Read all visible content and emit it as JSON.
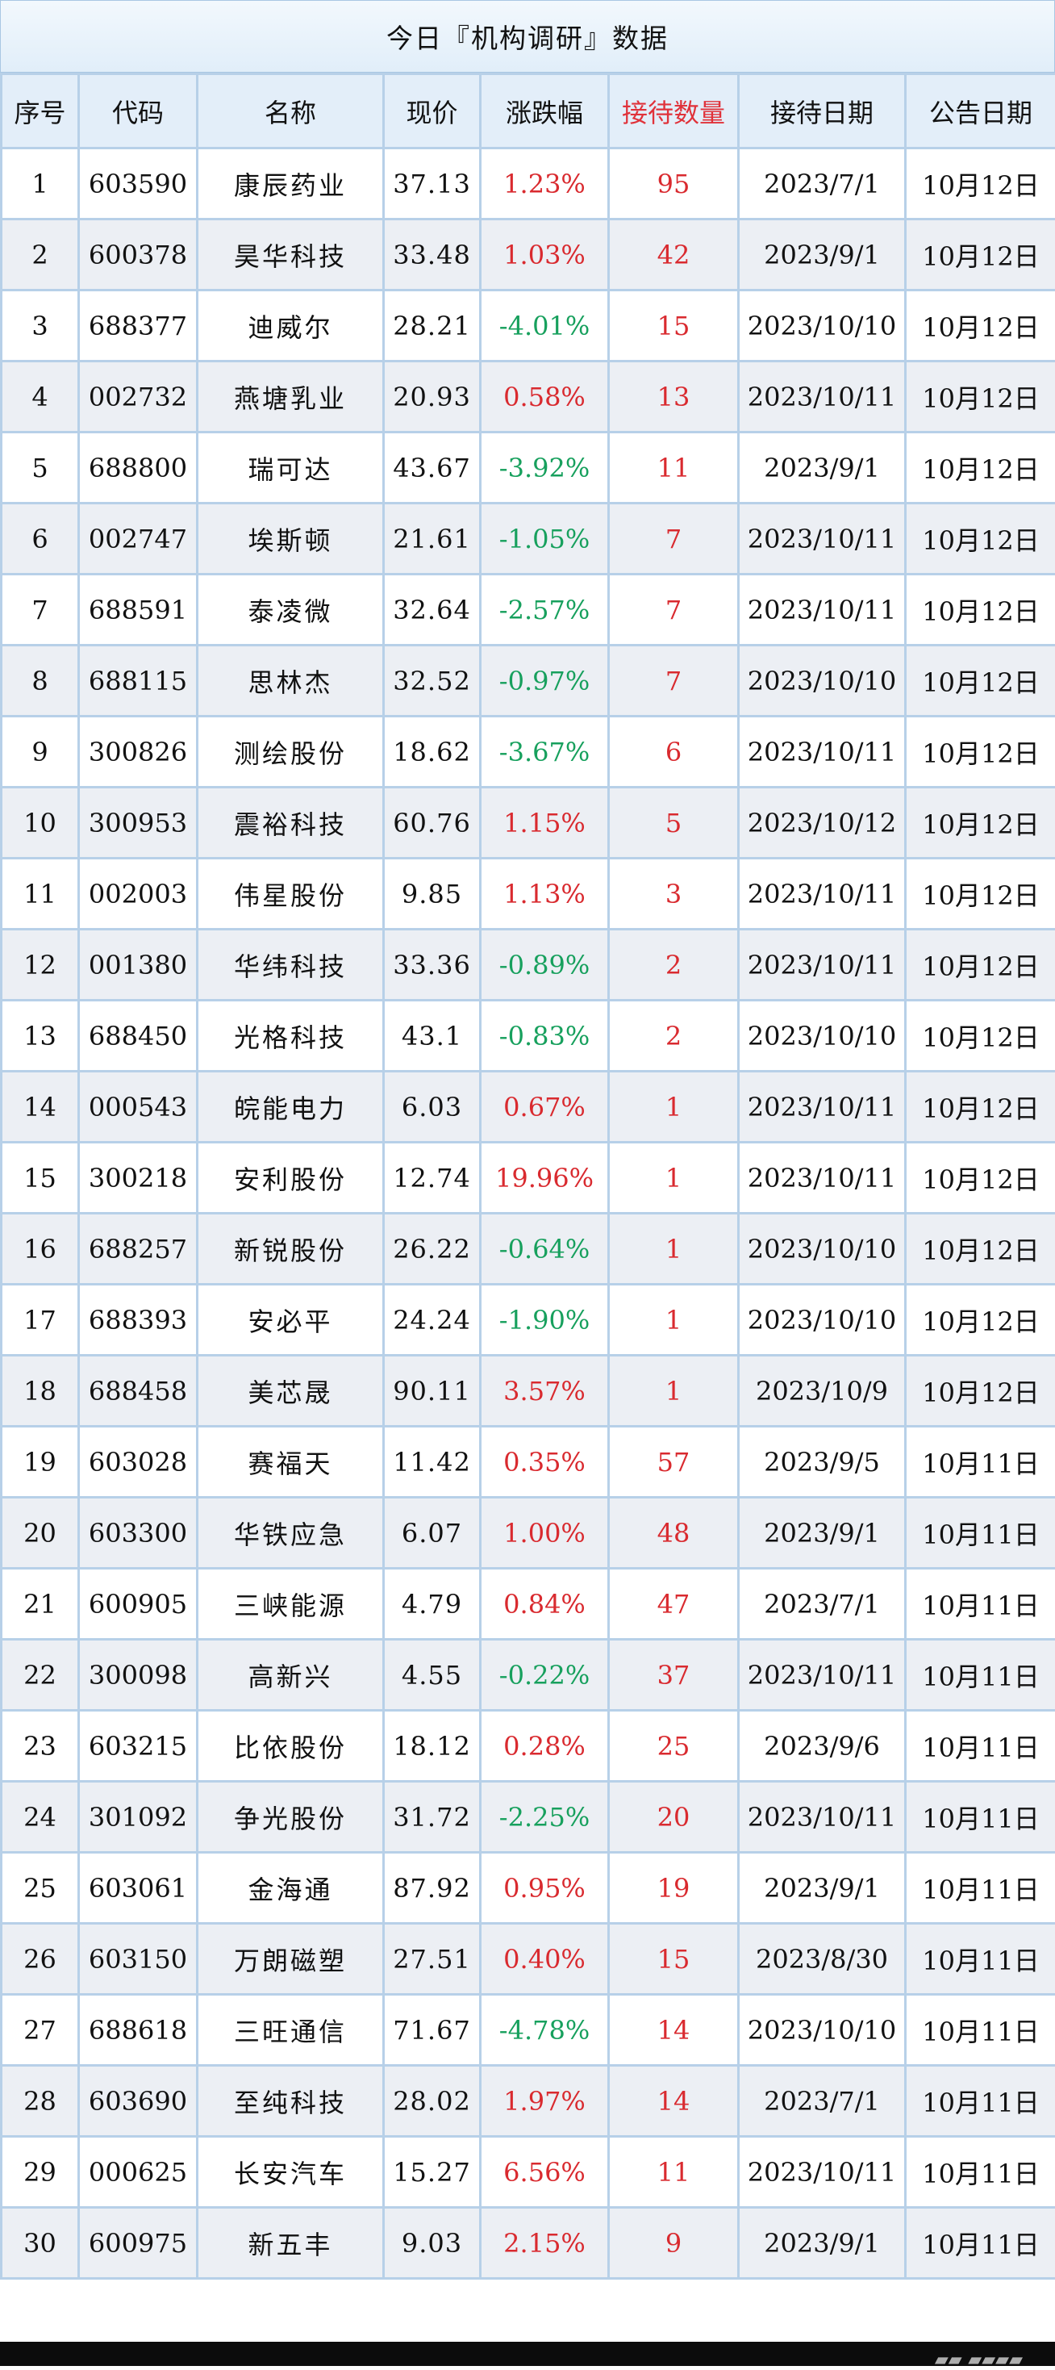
{
  "title": "今日『机构调研』数据",
  "headers": [
    "序号",
    "代码",
    "名称",
    "现价",
    "涨跌幅",
    "接待数量",
    "接待日期",
    "公告日期"
  ],
  "colors": {
    "header_bg": "#e3eef9",
    "border": "#b7d0e8",
    "up": "#d92a2f",
    "down": "#17a05d",
    "alt_row": "#eceff4"
  },
  "rows": [
    {
      "no": "1",
      "code": "603590",
      "name": "康辰药业",
      "price": "37.13",
      "change": "1.23%",
      "count": "95",
      "visit_date": "2023/7/1",
      "announce_date": "10月12日"
    },
    {
      "no": "2",
      "code": "600378",
      "name": "昊华科技",
      "price": "33.48",
      "change": "1.03%",
      "count": "42",
      "visit_date": "2023/9/1",
      "announce_date": "10月12日"
    },
    {
      "no": "3",
      "code": "688377",
      "name": "迪威尔",
      "price": "28.21",
      "change": "-4.01%",
      "count": "15",
      "visit_date": "2023/10/10",
      "announce_date": "10月12日"
    },
    {
      "no": "4",
      "code": "002732",
      "name": "燕塘乳业",
      "price": "20.93",
      "change": "0.58%",
      "count": "13",
      "visit_date": "2023/10/11",
      "announce_date": "10月12日"
    },
    {
      "no": "5",
      "code": "688800",
      "name": "瑞可达",
      "price": "43.67",
      "change": "-3.92%",
      "count": "11",
      "visit_date": "2023/9/1",
      "announce_date": "10月12日"
    },
    {
      "no": "6",
      "code": "002747",
      "name": "埃斯顿",
      "price": "21.61",
      "change": "-1.05%",
      "count": "7",
      "visit_date": "2023/10/11",
      "announce_date": "10月12日"
    },
    {
      "no": "7",
      "code": "688591",
      "name": "泰凌微",
      "price": "32.64",
      "change": "-2.57%",
      "count": "7",
      "visit_date": "2023/10/11",
      "announce_date": "10月12日"
    },
    {
      "no": "8",
      "code": "688115",
      "name": "思林杰",
      "price": "32.52",
      "change": "-0.97%",
      "count": "7",
      "visit_date": "2023/10/10",
      "announce_date": "10月12日"
    },
    {
      "no": "9",
      "code": "300826",
      "name": "测绘股份",
      "price": "18.62",
      "change": "-3.67%",
      "count": "6",
      "visit_date": "2023/10/11",
      "announce_date": "10月12日"
    },
    {
      "no": "10",
      "code": "300953",
      "name": "震裕科技",
      "price": "60.76",
      "change": "1.15%",
      "count": "5",
      "visit_date": "2023/10/12",
      "announce_date": "10月12日"
    },
    {
      "no": "11",
      "code": "002003",
      "name": "伟星股份",
      "price": "9.85",
      "change": "1.13%",
      "count": "3",
      "visit_date": "2023/10/11",
      "announce_date": "10月12日"
    },
    {
      "no": "12",
      "code": "001380",
      "name": "华纬科技",
      "price": "33.36",
      "change": "-0.89%",
      "count": "2",
      "visit_date": "2023/10/11",
      "announce_date": "10月12日"
    },
    {
      "no": "13",
      "code": "688450",
      "name": "光格科技",
      "price": "43.1",
      "change": "-0.83%",
      "count": "2",
      "visit_date": "2023/10/10",
      "announce_date": "10月12日"
    },
    {
      "no": "14",
      "code": "000543",
      "name": "皖能电力",
      "price": "6.03",
      "change": "0.67%",
      "count": "1",
      "visit_date": "2023/10/11",
      "announce_date": "10月12日"
    },
    {
      "no": "15",
      "code": "300218",
      "name": "安利股份",
      "price": "12.74",
      "change": "19.96%",
      "count": "1",
      "visit_date": "2023/10/11",
      "announce_date": "10月12日"
    },
    {
      "no": "16",
      "code": "688257",
      "name": "新锐股份",
      "price": "26.22",
      "change": "-0.64%",
      "count": "1",
      "visit_date": "2023/10/10",
      "announce_date": "10月12日"
    },
    {
      "no": "17",
      "code": "688393",
      "name": "安必平",
      "price": "24.24",
      "change": "-1.90%",
      "count": "1",
      "visit_date": "2023/10/10",
      "announce_date": "10月12日"
    },
    {
      "no": "18",
      "code": "688458",
      "name": "美芯晟",
      "price": "90.11",
      "change": "3.57%",
      "count": "1",
      "visit_date": "2023/10/9",
      "announce_date": "10月12日"
    },
    {
      "no": "19",
      "code": "603028",
      "name": "赛福天",
      "price": "11.42",
      "change": "0.35%",
      "count": "57",
      "visit_date": "2023/9/5",
      "announce_date": "10月11日"
    },
    {
      "no": "20",
      "code": "603300",
      "name": "华铁应急",
      "price": "6.07",
      "change": "1.00%",
      "count": "48",
      "visit_date": "2023/9/1",
      "announce_date": "10月11日"
    },
    {
      "no": "21",
      "code": "600905",
      "name": "三峡能源",
      "price": "4.79",
      "change": "0.84%",
      "count": "47",
      "visit_date": "2023/7/1",
      "announce_date": "10月11日"
    },
    {
      "no": "22",
      "code": "300098",
      "name": "高新兴",
      "price": "4.55",
      "change": "-0.22%",
      "count": "37",
      "visit_date": "2023/10/11",
      "announce_date": "10月11日"
    },
    {
      "no": "23",
      "code": "603215",
      "name": "比依股份",
      "price": "18.12",
      "change": "0.28%",
      "count": "25",
      "visit_date": "2023/9/6",
      "announce_date": "10月11日"
    },
    {
      "no": "24",
      "code": "301092",
      "name": "争光股份",
      "price": "31.72",
      "change": "-2.25%",
      "count": "20",
      "visit_date": "2023/10/11",
      "announce_date": "10月11日"
    },
    {
      "no": "25",
      "code": "603061",
      "name": "金海通",
      "price": "87.92",
      "change": "0.95%",
      "count": "19",
      "visit_date": "2023/9/1",
      "announce_date": "10月11日"
    },
    {
      "no": "26",
      "code": "603150",
      "name": "万朗磁塑",
      "price": "27.51",
      "change": "0.40%",
      "count": "15",
      "visit_date": "2023/8/30",
      "announce_date": "10月11日"
    },
    {
      "no": "27",
      "code": "688618",
      "name": "三旺通信",
      "price": "71.67",
      "change": "-4.78%",
      "count": "14",
      "visit_date": "2023/10/10",
      "announce_date": "10月11日"
    },
    {
      "no": "28",
      "code": "603690",
      "name": "至纯科技",
      "price": "28.02",
      "change": "1.97%",
      "count": "14",
      "visit_date": "2023/7/1",
      "announce_date": "10月11日"
    },
    {
      "no": "29",
      "code": "000625",
      "name": "长安汽车",
      "price": "15.27",
      "change": "6.56%",
      "count": "11",
      "visit_date": "2023/10/11",
      "announce_date": "10月11日"
    },
    {
      "no": "30",
      "code": "600975",
      "name": "新五丰",
      "price": "9.03",
      "change": "2.15%",
      "count": "9",
      "visit_date": "2023/9/1",
      "announce_date": "10月11日"
    }
  ]
}
